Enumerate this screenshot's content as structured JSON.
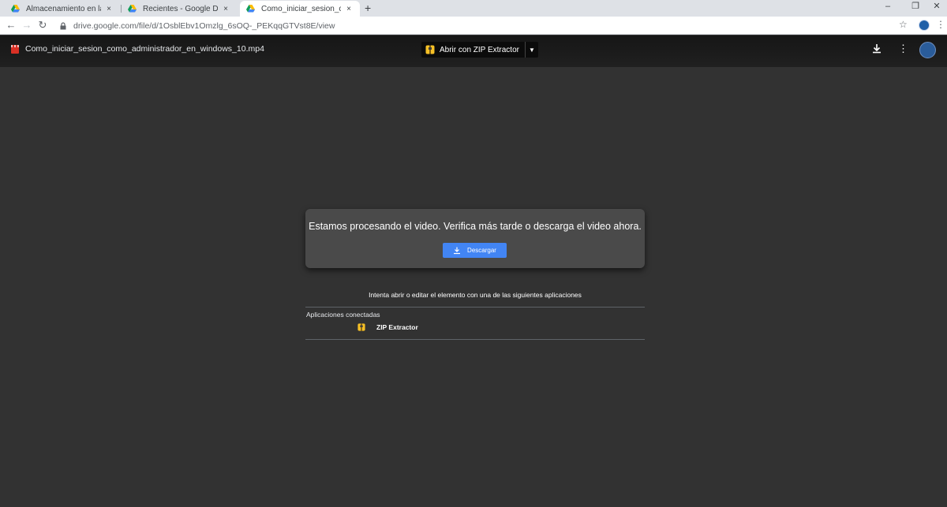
{
  "browser": {
    "tabs": [
      {
        "title": "Almacenamiento en la nube para",
        "close": "×",
        "active": false
      },
      {
        "title": "Recientes - Google Drive",
        "close": "×",
        "active": false
      },
      {
        "title": "Como_iniciar_sesion_como_admi",
        "close": "×",
        "active": true
      }
    ],
    "new_tab": "+",
    "window_controls": {
      "minimize": "–",
      "maximize": "❐",
      "close": "✕"
    },
    "nav": {
      "back": "←",
      "forward": "→",
      "reload": "↻"
    },
    "url": "drive.google.com/file/d/1OsblEbv1Omzlg_6sOQ-_PEKqqGTVst8E/view",
    "bookmark_star": "☆",
    "menu": "⋮"
  },
  "viewer": {
    "file_name": "Como_iniciar_sesion_como_administrador_en_windows_10.mp4",
    "open_with_label": "Abrir con ZIP Extractor",
    "caret": "▼",
    "more": "⋮"
  },
  "message": {
    "text": "Estamos procesando el video. Verifica más tarde o descarga el video ahora.",
    "download_button": "Descargar"
  },
  "apps": {
    "hint": "Intenta abrir o editar el elemento con una de las siguientes aplicaciones",
    "section_label": "Aplicaciones conectadas",
    "items": [
      {
        "name": "ZIP Extractor"
      }
    ]
  },
  "colors": {
    "background": "#323232",
    "card": "#4a4a4a",
    "accent_blue": "#4285f4",
    "file_red": "#d93025"
  }
}
